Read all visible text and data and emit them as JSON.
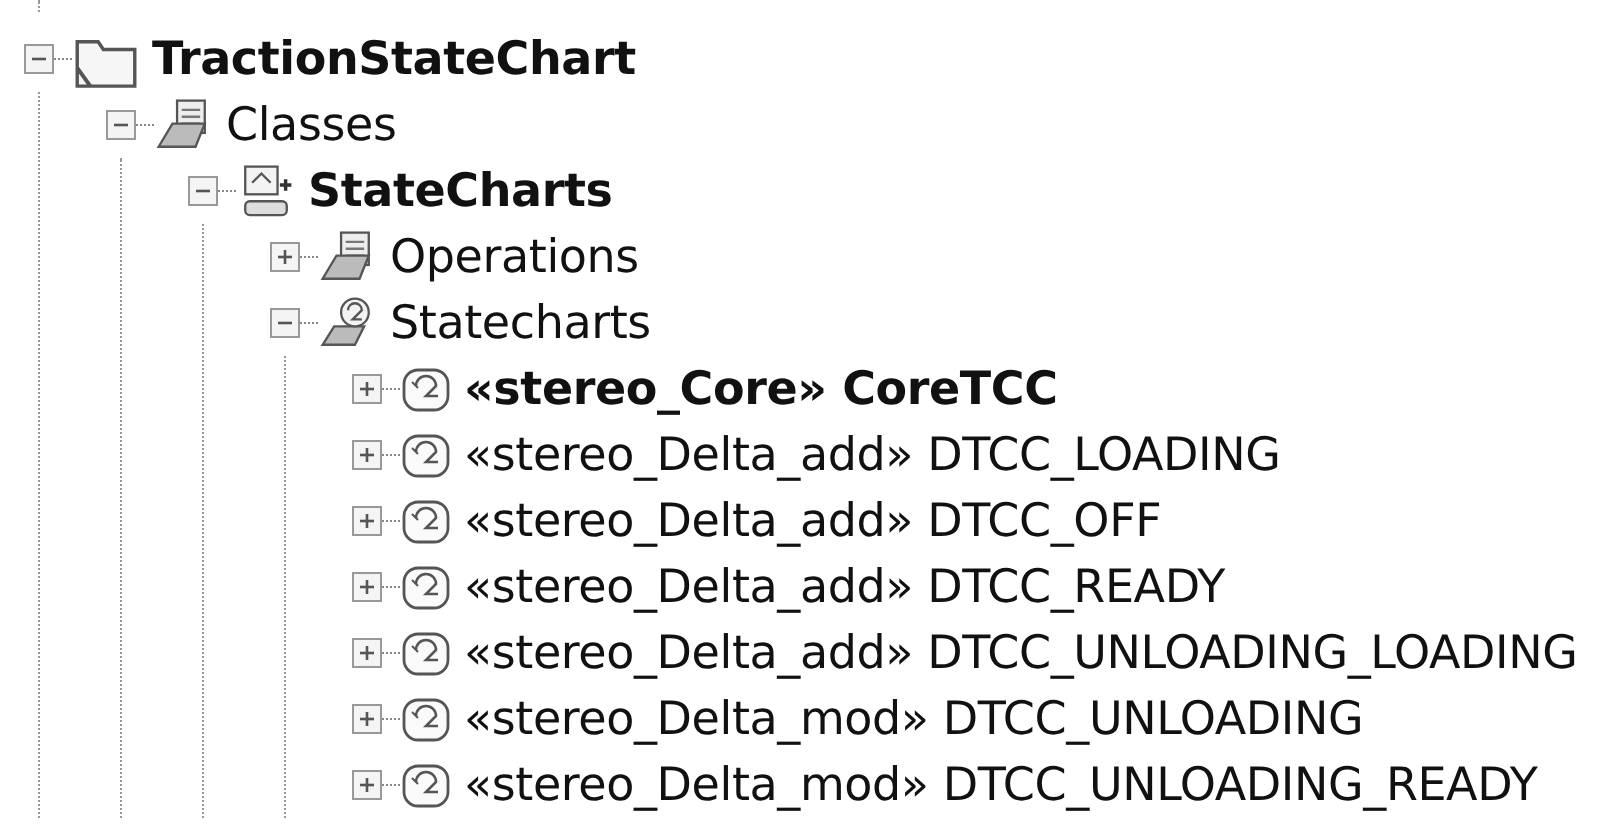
{
  "tree": [
    {
      "label": "TractionStateChart",
      "kind": "folder",
      "bold": true,
      "expanded": true,
      "children": [
        {
          "label": "Classes",
          "kind": "package",
          "bold": false,
          "expanded": true,
          "children": [
            {
              "label": "StateCharts",
              "kind": "class",
              "bold": true,
              "expanded": true,
              "children": [
                {
                  "label": "Operations",
                  "kind": "package",
                  "bold": false,
                  "expanded": false
                },
                {
                  "label": "Statecharts",
                  "kind": "charts",
                  "bold": false,
                  "expanded": true,
                  "children": [
                    {
                      "label": "«stereo_Core» CoreTCC",
                      "kind": "statechart",
                      "bold": true,
                      "expanded": false
                    },
                    {
                      "label": "«stereo_Delta_add» DTCC_LOADING",
                      "kind": "statechart",
                      "bold": false,
                      "expanded": false
                    },
                    {
                      "label": "«stereo_Delta_add» DTCC_OFF",
                      "kind": "statechart",
                      "bold": false,
                      "expanded": false
                    },
                    {
                      "label": "«stereo_Delta_add» DTCC_READY",
                      "kind": "statechart",
                      "bold": false,
                      "expanded": false
                    },
                    {
                      "label": "«stereo_Delta_add» DTCC_UNLOADING_LOADING",
                      "kind": "statechart",
                      "bold": false,
                      "expanded": false
                    },
                    {
                      "label": "«stereo_Delta_mod» DTCC_UNLOADING",
                      "kind": "statechart",
                      "bold": false,
                      "expanded": false
                    },
                    {
                      "label": "«stereo_Delta_mod» DTCC_UNLOADING_READY",
                      "kind": "statechart",
                      "bold": false,
                      "expanded": false
                    }
                  ]
                }
              ]
            }
          ]
        }
      ]
    }
  ]
}
